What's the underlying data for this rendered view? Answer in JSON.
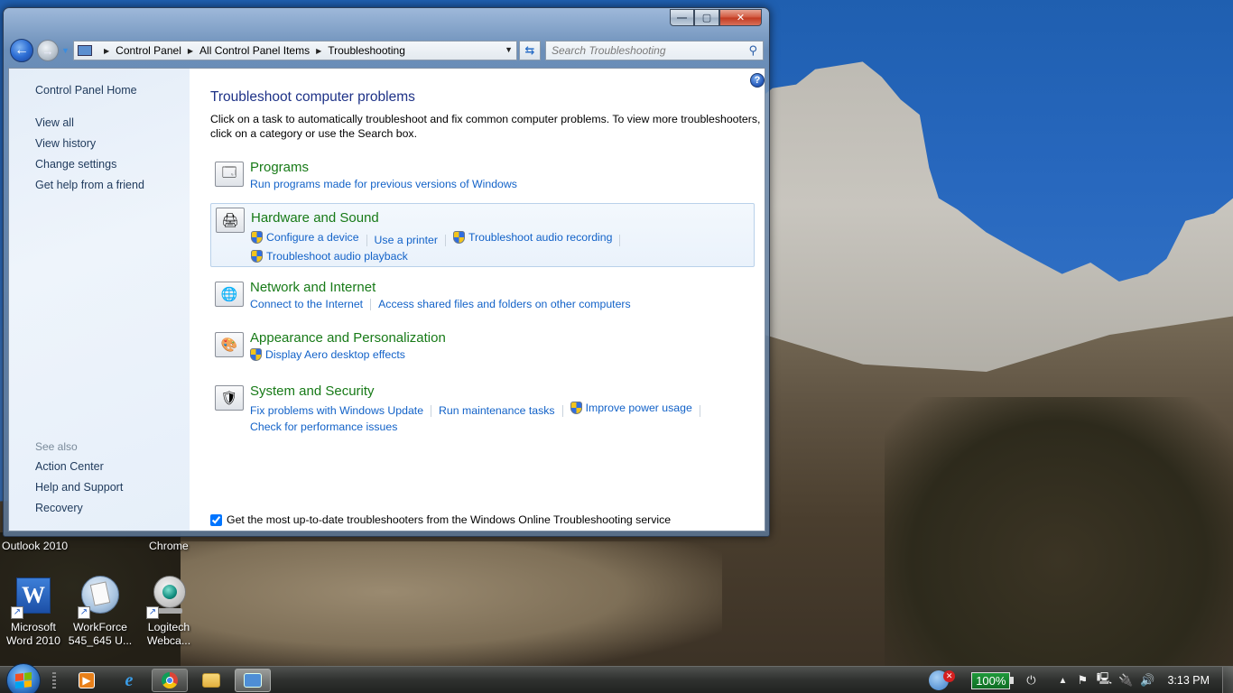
{
  "window": {
    "controls": {
      "minimize": "—",
      "maximize": "▢",
      "close": "✕"
    },
    "address": {
      "crumbs": [
        "Control Panel",
        "All Control Panel Items",
        "Troubleshooting"
      ]
    },
    "search": {
      "placeholder": "Search Troubleshooting"
    },
    "help_label": "?"
  },
  "sidebar": {
    "home": "Control Panel Home",
    "links": [
      "View all",
      "View history",
      "Change settings",
      "Get help from a friend"
    ],
    "see_also_label": "See also",
    "see_also": [
      "Action Center",
      "Help and Support",
      "Recovery"
    ]
  },
  "main": {
    "title": "Troubleshoot computer problems",
    "intro": "Click on a task to automatically troubleshoot and fix common computer problems. To view more troubleshooters, click on a category or use the Search box.",
    "categories": [
      {
        "title": "Programs",
        "icon": "programs-icon",
        "tasks": [
          {
            "label": "Run programs made for previous versions of Windows",
            "shield": false
          }
        ]
      },
      {
        "title": "Hardware and Sound",
        "icon": "hardware-sound-icon",
        "highlighted": true,
        "tasks": [
          {
            "label": "Configure a device",
            "shield": true
          },
          {
            "label": "Use a printer",
            "shield": false
          },
          {
            "label": "Troubleshoot audio recording",
            "shield": true
          },
          {
            "label": "Troubleshoot audio playback",
            "shield": true
          }
        ]
      },
      {
        "title": "Network and Internet",
        "icon": "network-internet-icon",
        "tasks": [
          {
            "label": "Connect to the Internet",
            "shield": false
          },
          {
            "label": "Access shared files and folders on other computers",
            "shield": false
          }
        ]
      },
      {
        "title": "Appearance and Personalization",
        "icon": "appearance-personalization-icon",
        "tasks": [
          {
            "label": "Display Aero desktop effects",
            "shield": true
          }
        ]
      },
      {
        "title": "System and Security",
        "icon": "system-security-icon",
        "tasks": [
          {
            "label": "Fix problems with Windows Update",
            "shield": false
          },
          {
            "label": "Run maintenance tasks",
            "shield": false
          },
          {
            "label": "Improve power usage",
            "shield": true
          },
          {
            "label": "Check for performance issues",
            "shield": false
          }
        ]
      }
    ],
    "online_checkbox": {
      "label": "Get the most up-to-date troubleshooters from the Windows Online Troubleshooting service",
      "checked": true
    }
  },
  "desktop": {
    "labels": [
      "Outlook 2010",
      "Chrome"
    ],
    "icons": [
      {
        "caption1": "Microsoft",
        "caption2": "Word 2010",
        "icon": "word-icon"
      },
      {
        "caption1": "WorkForce",
        "caption2": "545_645 U...",
        "icon": "workforce-icon"
      },
      {
        "caption1": "Logitech",
        "caption2": "Webca...",
        "icon": "webcam-icon"
      }
    ]
  },
  "taskbar": {
    "pinned": [
      "windows-media-player",
      "internet-explorer",
      "chrome",
      "windows-explorer",
      "control-panel"
    ],
    "tray": {
      "battery": "100%",
      "clock": "3:13 PM"
    }
  },
  "colors": {
    "title_blue": "#1e3287",
    "category_green": "#177a17",
    "link_blue": "#1262c8",
    "sidebar_link": "#1e395b",
    "battery_green": "#1e9a3a"
  }
}
